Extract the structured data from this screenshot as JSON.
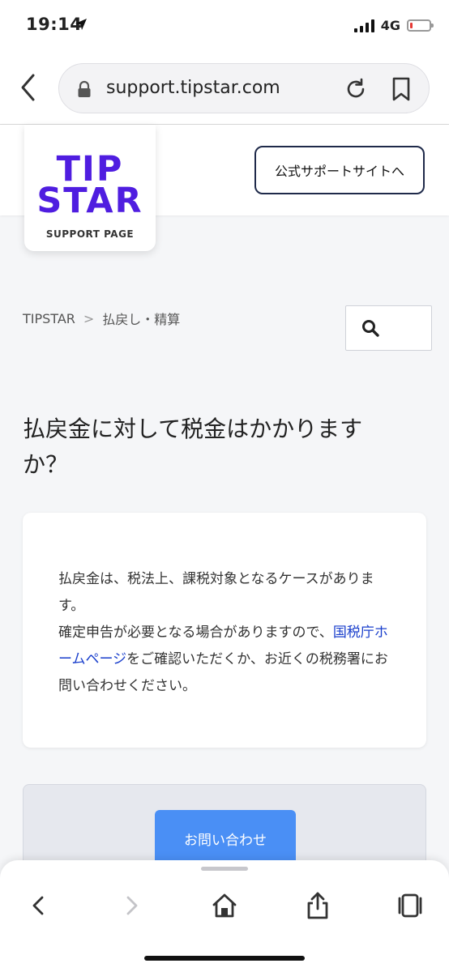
{
  "status_bar": {
    "time": "19:14",
    "network": "4G",
    "battery_level": 0.12,
    "battery_color": "#e53935"
  },
  "browser": {
    "url": "support.tipstar.com",
    "icons": [
      "back-chevron-icon",
      "lock-icon",
      "reload-icon",
      "bookmark-icon"
    ]
  },
  "header": {
    "logo_line1": "TIP",
    "logo_line2": "STAR",
    "logo_sub": "SUPPORT PAGE",
    "official_button": "公式サポートサイトへ",
    "brand_color": "#4f1de0"
  },
  "breadcrumb": {
    "root": "TIPSTAR",
    "separator": ">",
    "current": "払戻し・精算"
  },
  "search": {
    "icon": "search-icon"
  },
  "article": {
    "title": "払戻金に対して税金はかかりますか？",
    "body_part1": "払戻金は、税法上、課税対象となるケースがあります。",
    "body_part2": "確定申告が必要となる場合がありますので、",
    "link_text": "国税庁ホームページ",
    "body_part3": "をご確認いただくか、お近くの税務署にお問い合わせください。",
    "link_color": "#1a3fcc"
  },
  "contact": {
    "button_label": "お問い合わせ",
    "button_color": "#4a8ff5"
  },
  "toolbar": {
    "icons": [
      "back-icon",
      "forward-icon",
      "home-icon",
      "share-icon",
      "tabs-icon"
    ]
  }
}
